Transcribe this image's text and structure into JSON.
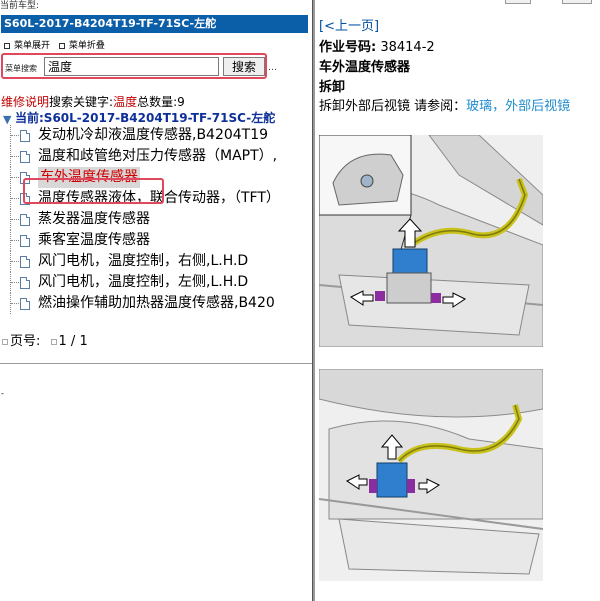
{
  "topbar": {
    "label": "当前车型:"
  },
  "left": {
    "title": "S60L-2017-B4204T19-TF-71SC-左舵",
    "tools": {
      "expand": "菜单展开",
      "collapse": "菜单折叠"
    },
    "search": {
      "label": "菜单搜索",
      "value": "温度",
      "button": "搜索"
    },
    "ellipsis": "…",
    "info": {
      "prefix": "维修说明",
      "keyword_label": "搜索关键字:",
      "keyword": "温度",
      "count_label": "总数量:",
      "count": "9"
    },
    "current": "当前:S60L-2017-B4204T19-TF-71SC-左舵",
    "items": [
      "发动机冷却液温度传感器,B4204T19",
      "温度和歧管绝对压力传感器（MAPT）,",
      "车外温度传感器",
      "温度传感器液体，联合传动器，（TFT）",
      "蒸发器温度传感器",
      "乘客室温度传感器",
      "风门电机，温度控制，右侧,L.H.D",
      "风门电机，温度控制，左侧,L.H.D",
      "燃油操作辅助加热器温度传感器,B420"
    ],
    "selected_index": 2,
    "pager": {
      "label": "页号:",
      "value": "1 / 1"
    },
    "tiny_mark": "-"
  },
  "right": {
    "back": "[<上一页]",
    "job_label": "作业号码:",
    "job_number": "38414-2",
    "heading": "车外温度传感器",
    "section": "拆卸",
    "step_text": "拆卸外部后视镜 请参阅：",
    "step_link": "玻璃，外部后视镜"
  },
  "colors": {
    "title_bg": "#0b5ea8",
    "highlight": "#e0485e",
    "link": "#1f8ccf",
    "current": "#0d2f9a"
  }
}
